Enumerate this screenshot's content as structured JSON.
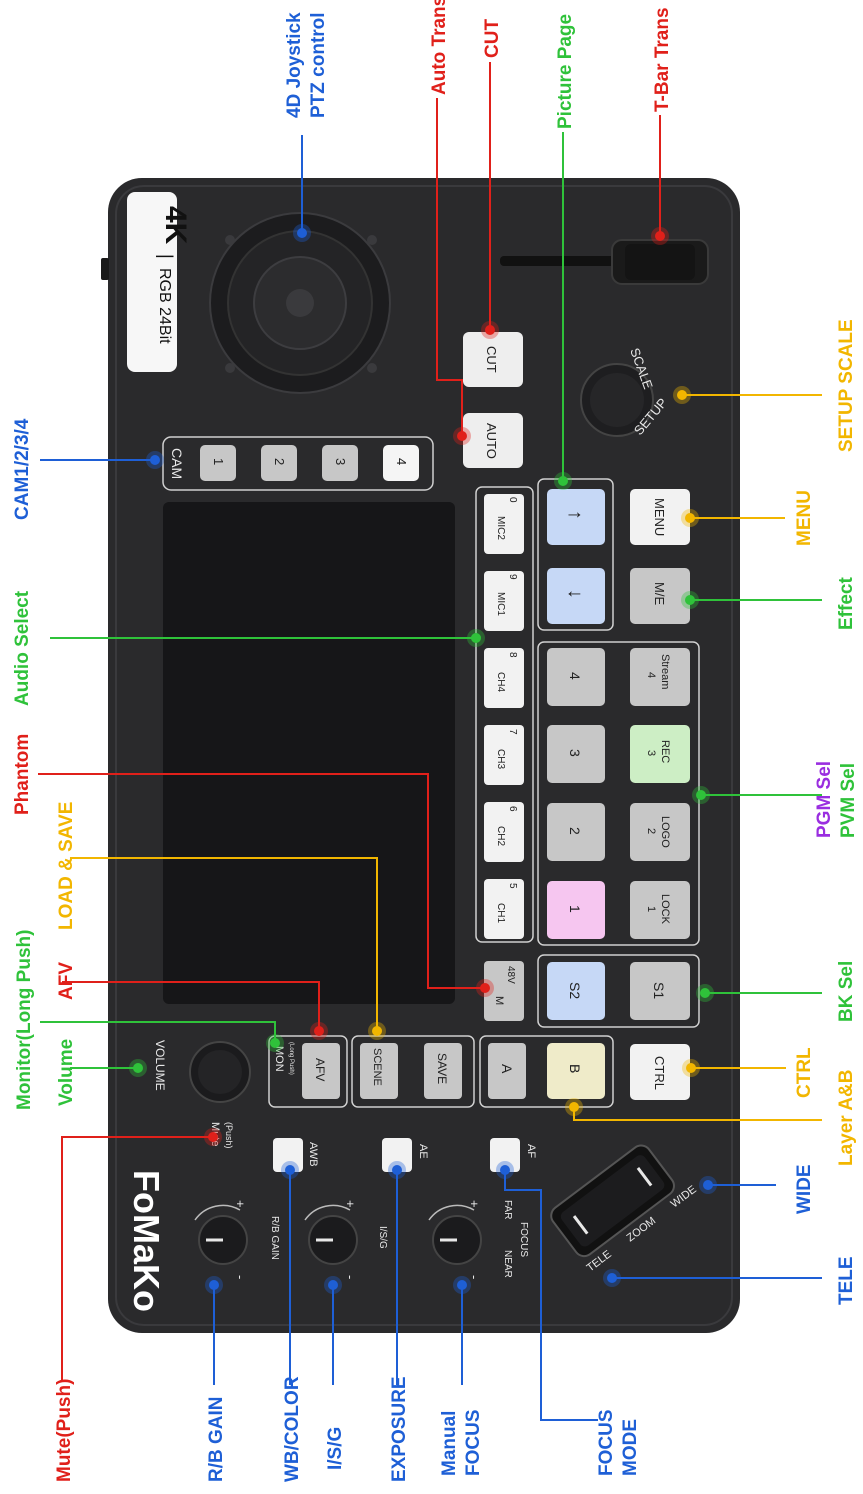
{
  "device": {
    "brand": "FoMaKo",
    "badge_left": "RGB 24Bit",
    "badge_sep": "|",
    "badge_right": "4K",
    "cam_label": "CAM",
    "cam_buttons": [
      "1",
      "2",
      "3",
      "4"
    ],
    "auto_button": "AUTO",
    "cut_button": "CUT",
    "audio_buttons": [
      {
        "name": "MIC2",
        "num": "0"
      },
      {
        "name": "MIC1",
        "num": "9"
      },
      {
        "name": "CH4",
        "num": "8"
      },
      {
        "name": "CH3",
        "num": "7"
      },
      {
        "name": "CH2",
        "num": "6"
      },
      {
        "name": "CH1",
        "num": "5"
      }
    ],
    "phantom_button": {
      "left": "M",
      "right": "48V"
    },
    "page_up": "↑",
    "page_down": "↓",
    "pgm_buttons": [
      "4",
      "3",
      "2",
      "1"
    ],
    "pvm_buttons": [
      {
        "num": "4",
        "name": "Stream"
      },
      {
        "num": "3",
        "name": "REC"
      },
      {
        "num": "2",
        "name": "LOGO"
      },
      {
        "num": "1",
        "name": "LOCK"
      }
    ],
    "s2_button": "S2",
    "s1_button": "S1",
    "menu_button": "MENU",
    "me_button": "M/E",
    "ctrl_button": "CTRL",
    "setup_label": "SETUP",
    "scale_label": "SCALE",
    "volume_label": "VOLUME",
    "mute_label": "Mute",
    "mute_sub": "(Push)",
    "mon_label": "MON",
    "mon_sub": "(Long Push)",
    "afv_button": "AFV",
    "scene_button": "SCENE",
    "save_button": "SAVE",
    "a_button": "A",
    "b_button": "B",
    "awb_label": "AWB",
    "ae_label": "AE",
    "af_label": "AF",
    "rb_gain_label": "R/B GAIN",
    "isg_label": "I/S/G",
    "focus_label": "FOCUS",
    "near_label": "NEAR",
    "far_label": "FAR",
    "plus": "+",
    "minus": "-",
    "tele_label": "TELE",
    "zoom_label": "ZOOM",
    "wide_label": "WIDE"
  },
  "callouts": {
    "joystick_1": "4D Joystick",
    "joystick_2": "PTZ control",
    "auto_trans": "Auto Trans",
    "cut": "CUT",
    "picture_page": "Picture Page",
    "tbar": "T-Bar Trans",
    "setup_scale": "SETUP SCALE",
    "cam": "CAM1/2/3/4",
    "menu": "MENU",
    "audio_select": "Audio Select",
    "effect": "Effect",
    "phantom": "Phantom",
    "load_save": "LOAD & SAVE",
    "pgm_sel": "PGM Sel",
    "pvm_sel": "PVM Sel",
    "monitor": "Monitor(Long Push)",
    "afv": "AFV",
    "volume": "Volume",
    "bk_sel": "BK Sel",
    "ctrl": "CTRL",
    "layer_ab": "Layer A&B",
    "wide": "WIDE",
    "tele": "TELE",
    "mute_push": "Mute(Push)",
    "rb_gain": "R/B GAIN",
    "wb_color": "WB/COLOR",
    "isg": "I/S/G",
    "exposure": "EXPOSURE",
    "manual_1": "Manual",
    "manual_2": "FOCUS",
    "focus_mode_1": "FOCUS",
    "focus_mode_2": "MODE"
  },
  "colors": {
    "blue": "#1e5fd6",
    "red": "#e0201a",
    "green": "#2fc23a",
    "yellow": "#f2b600",
    "purple": "#9a2ee0",
    "body": "#2a2a2c",
    "screen": "#161618",
    "btn_gray": "#c7c7c7",
    "btn_blue": "#c6d8f6",
    "btn_pink": "#f6c6f0",
    "btn_green": "#cdeec5",
    "btn_cream": "#efebc9"
  }
}
